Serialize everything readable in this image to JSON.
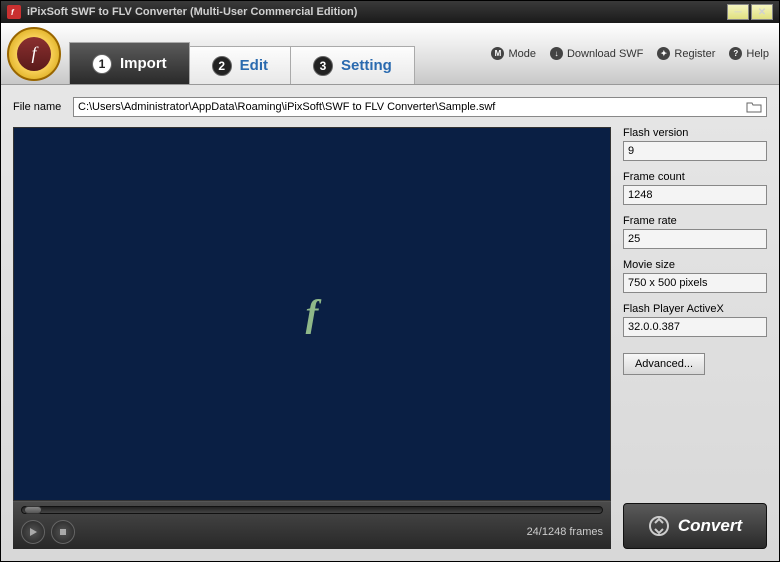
{
  "window": {
    "title": "iPixSoft SWF to FLV Converter (Multi-User Commercial Edition)"
  },
  "tabs": [
    {
      "num": "1",
      "label": "Import"
    },
    {
      "num": "2",
      "label": "Edit"
    },
    {
      "num": "3",
      "label": "Setting"
    }
  ],
  "toplinks": {
    "mode": "Mode",
    "download": "Download SWF",
    "register": "Register",
    "help": "Help"
  },
  "file": {
    "label": "File name",
    "path": "C:\\Users\\Administrator\\AppData\\Roaming\\iPixSoft\\SWF to FLV Converter\\Sample.swf"
  },
  "info": {
    "flash_version_label": "Flash version",
    "flash_version": "9",
    "frame_count_label": "Frame count",
    "frame_count": "1248",
    "frame_rate_label": "Frame rate",
    "frame_rate": "25",
    "movie_size_label": "Movie size",
    "movie_size": "750 x 500 pixels",
    "activex_label": "Flash Player ActiveX",
    "activex": "32.0.0.387"
  },
  "buttons": {
    "advanced": "Advanced...",
    "convert": "Convert"
  },
  "player": {
    "frames": "24/1248 frames"
  }
}
